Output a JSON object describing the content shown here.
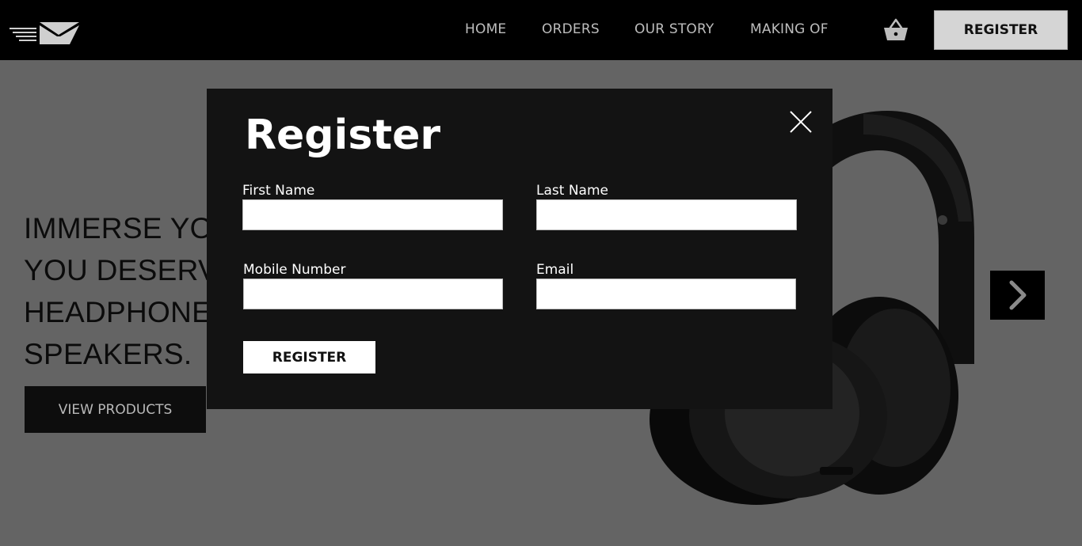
{
  "nav": {
    "links": [
      "HOME",
      "ORDERS",
      "OUR STORY",
      "MAKING OF"
    ],
    "register_label": "REGISTER",
    "logo_icon": "logo-mail-speed-icon",
    "cart_icon": "basket-icon"
  },
  "hero": {
    "lines": [
      "IMMERSE YO",
      "YOU DESERV",
      "HEADPHONE",
      "SPEAKERS."
    ],
    "cta_label": "VIEW PRODUCTS",
    "next_icon": "chevron-right-icon"
  },
  "modal": {
    "title": "Register",
    "close_icon": "close-icon",
    "fields": {
      "first_name": {
        "label": "First Name",
        "value": "",
        "placeholder": ""
      },
      "last_name": {
        "label": "Last Name",
        "value": "",
        "placeholder": ""
      },
      "mobile": {
        "label": "Mobile Number",
        "value": "",
        "placeholder": ""
      },
      "email": {
        "label": "Email",
        "value": "",
        "placeholder": ""
      }
    },
    "submit_label": "REGISTER"
  },
  "colors": {
    "navbar": "#000000",
    "overlay_background": "#646464",
    "modal_background": "#131313",
    "register_button": "#d5d5d5"
  }
}
